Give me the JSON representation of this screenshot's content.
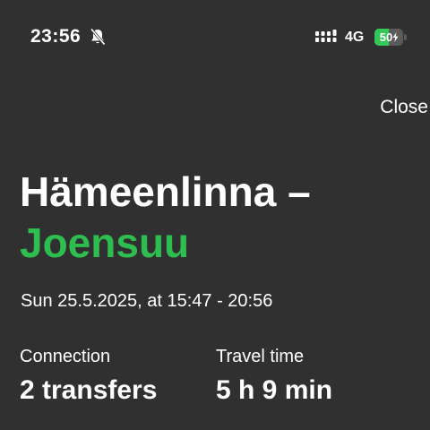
{
  "status_bar": {
    "time": "23:56",
    "mute_icon": "bell-slash-icon",
    "signal_icon": "cellular-signal-icon",
    "network": "4G",
    "battery_percent": "50",
    "battery_level": 0.5,
    "battery_color": "#34c759"
  },
  "header": {
    "close_label": "Close"
  },
  "route": {
    "origin": "Hämeenlinna –",
    "destination": "Joensuu",
    "destination_color": "#2ebd4f",
    "date_time": "Sun 25.5.2025, at 15:47 - 20:56"
  },
  "stats": {
    "connection_label": "Connection",
    "connection_value": "2 transfers",
    "travel_time_label": "Travel time",
    "travel_time_value": "5 h 9 min"
  }
}
